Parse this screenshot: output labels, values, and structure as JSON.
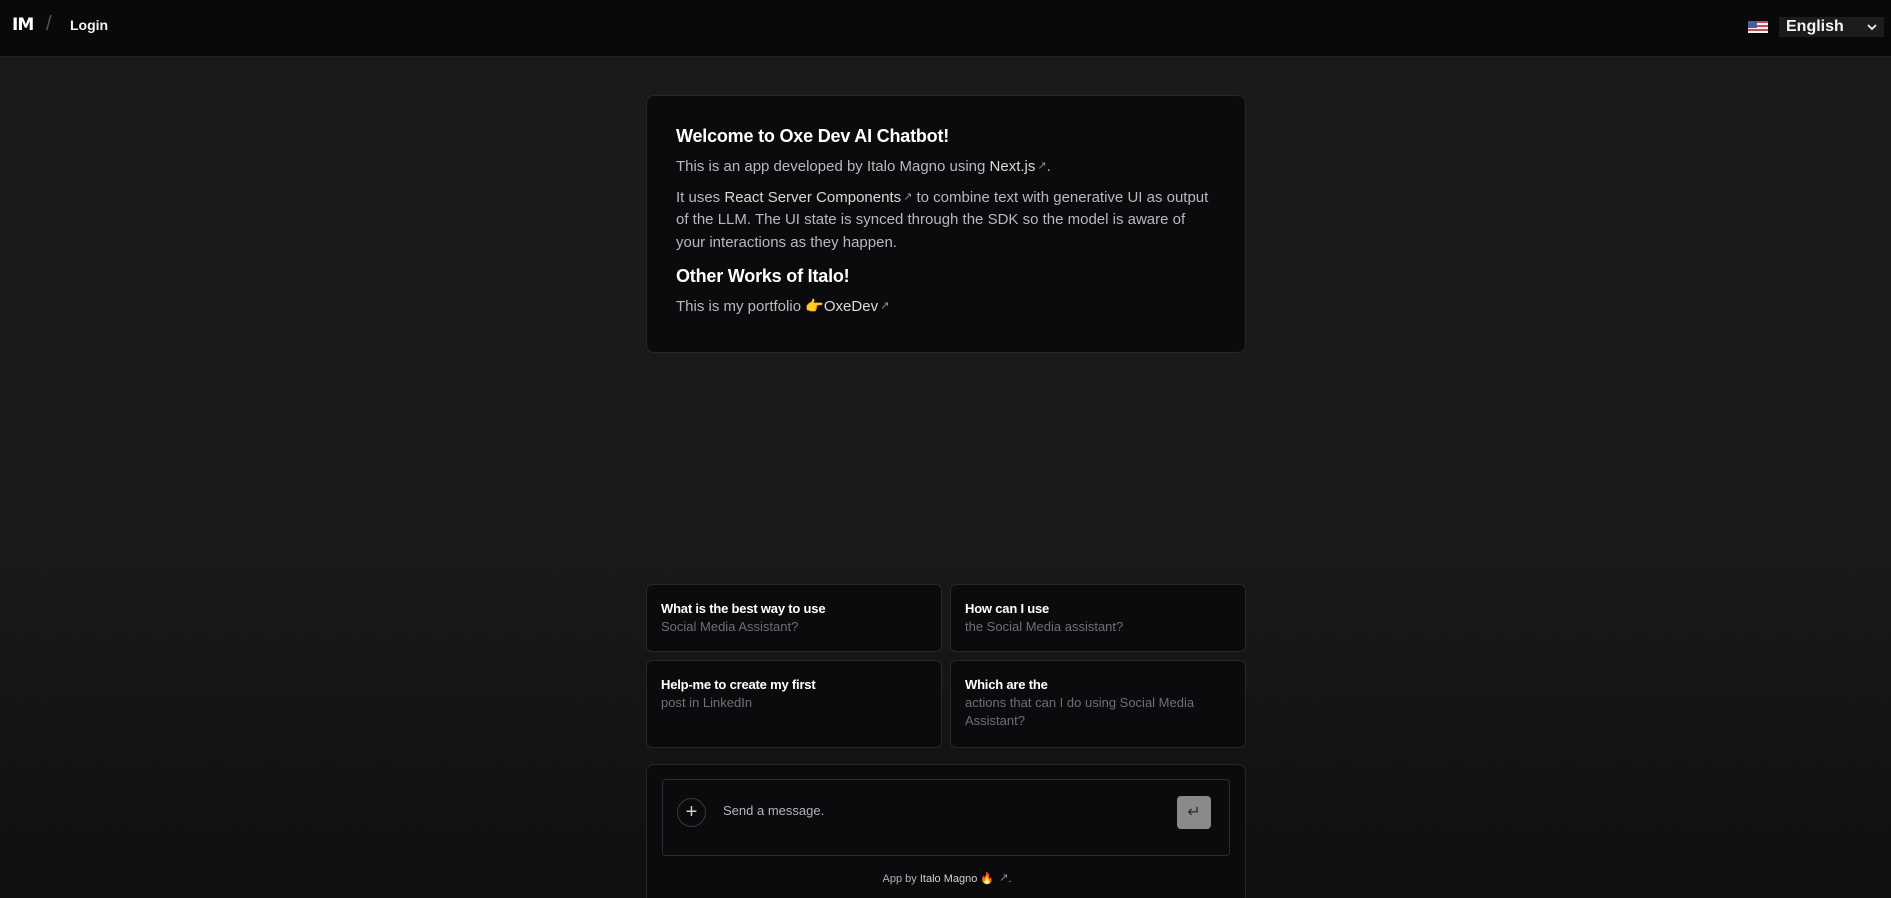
{
  "header": {
    "logo_text": "IM",
    "separator": "/",
    "login_label": "Login",
    "language": {
      "selected": "English",
      "flag": "us-flag-icon"
    }
  },
  "welcome": {
    "title": "Welcome to Oxe Dev AI Chatbot!",
    "intro_prefix": "This is an app developed by Italo Magno using ",
    "intro_link": "Next.js",
    "intro_suffix": ".",
    "rsc_link": "React Server Components",
    "rsc_prefix": "It uses ",
    "rsc_suffix": " to combine text with generative UI as output of the LLM. The UI state is synced through the SDK so the model is aware of your interactions as they happen.",
    "other_title": "Other Works of Italo!",
    "portfolio_prefix": "This is my portfolio 👉",
    "portfolio_link": "OxeDev",
    "ext_glyph": "↗"
  },
  "suggestions": [
    {
      "heading": "What is the best way to use",
      "sub": "Social Media Assistant?"
    },
    {
      "heading": "How can I use",
      "sub": "the Social Media assistant?"
    },
    {
      "heading": "Help-me to create my first",
      "sub": "post in LinkedIn"
    },
    {
      "heading": "Which are the",
      "sub": "actions that can I do using Social Media Assistant?"
    }
  ],
  "composer": {
    "placeholder": "Send a message.",
    "plus_glyph": "+",
    "send_glyph": "↵"
  },
  "footer": {
    "prefix": "App by ",
    "author": "Italo Magno 🔥",
    "ext_glyph": "↗",
    "suffix": "."
  },
  "colors": {
    "background": "#1a1a1c",
    "card": "#0b0b0d",
    "border": "#27272a",
    "send_button": "#8a8a8d"
  }
}
